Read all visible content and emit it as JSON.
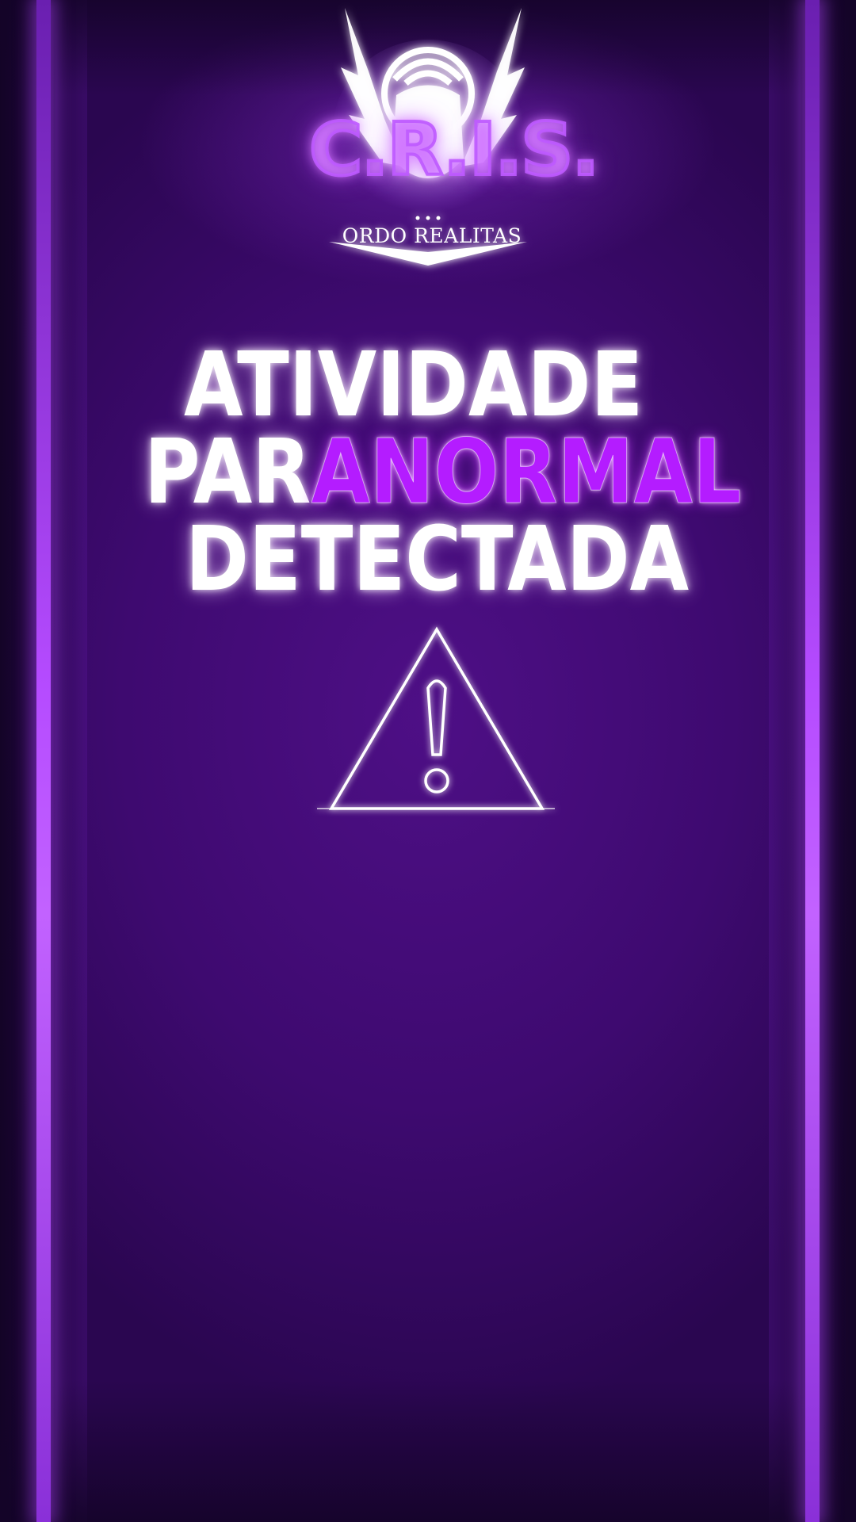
{
  "logo": {
    "wordmark": "C.R.I.S.",
    "subtitle": "ORDO REALITAS"
  },
  "headline": {
    "line1": "ATIVIDADE",
    "line2_prefix": "PAR",
    "line2_accent": "ANORMAL",
    "line3": "DETECTADA"
  },
  "icons": {
    "logo_emblem": "winged-seal-icon",
    "warning": "warning-triangle-icon"
  },
  "colors": {
    "background": "#3e0a70",
    "accent": "#b41cff",
    "side_bars": "#b54bff",
    "text": "#ffffff"
  }
}
